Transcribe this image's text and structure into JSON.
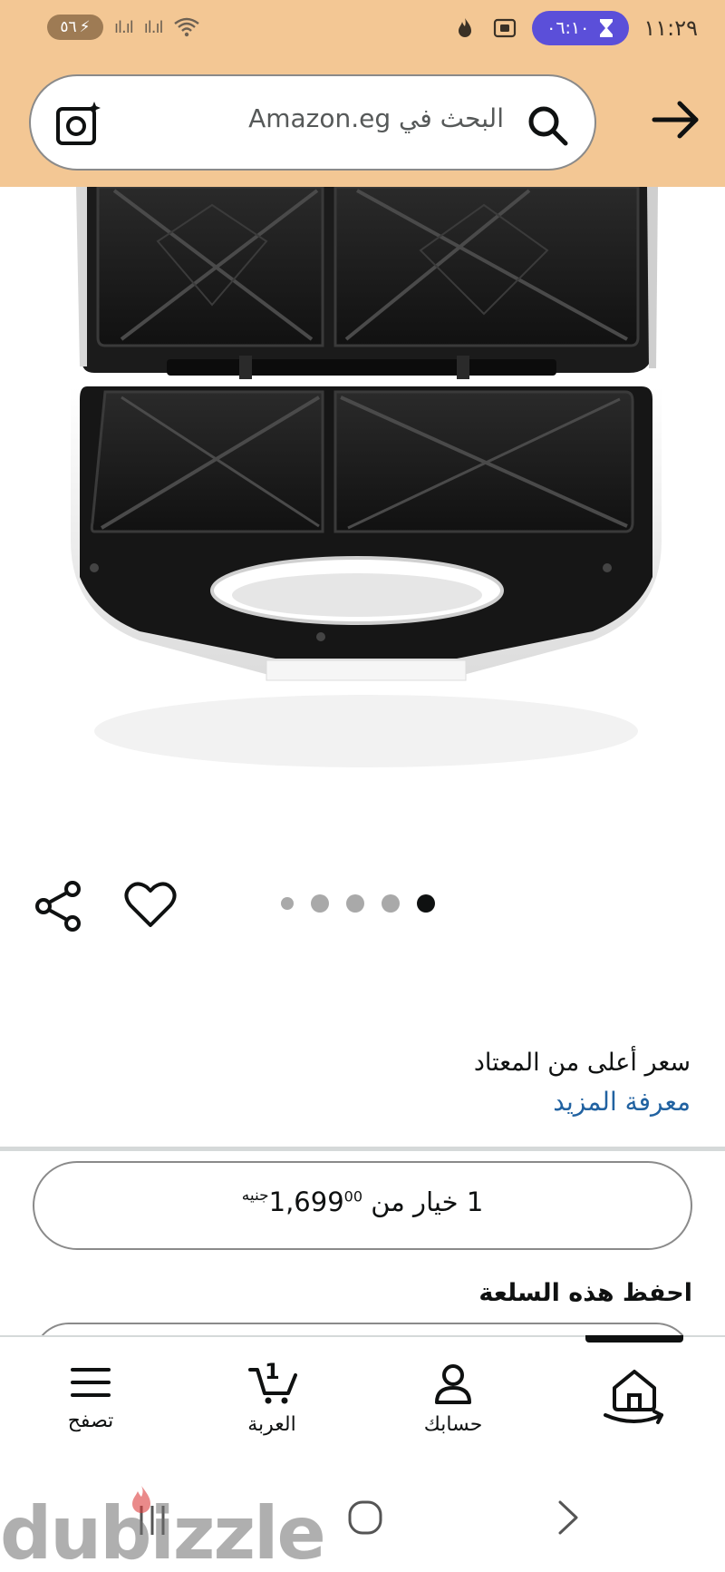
{
  "status_bar": {
    "battery": "٥٦",
    "time": "١١:٢٩",
    "timer": "٠٦:١٠"
  },
  "search": {
    "placeholder": "البحث في Amazon.eg"
  },
  "carousel": {
    "total": 5,
    "active_index": 4
  },
  "product": {
    "price_note": "سعر أعلى من المعتاد",
    "learn_more": "معرفة المزيد",
    "options_prefix": "1 خيار من",
    "price_whole": "1,699",
    "price_fraction": "00",
    "currency": "جنيه",
    "save_title": "احفظ هذه السلعة"
  },
  "bottom_nav": {
    "items": [
      {
        "label": "تصفح",
        "icon": "menu-icon"
      },
      {
        "label": "العربة",
        "icon": "cart-icon",
        "count": "1"
      },
      {
        "label": "حسابك",
        "icon": "account-icon"
      },
      {
        "label": "",
        "icon": "home-icon"
      }
    ]
  },
  "watermark": {
    "text": "dubizzle"
  },
  "colors": {
    "header_bg": "#f3c794",
    "link": "#2162a1",
    "timer_pill": "#5b4fd9"
  }
}
